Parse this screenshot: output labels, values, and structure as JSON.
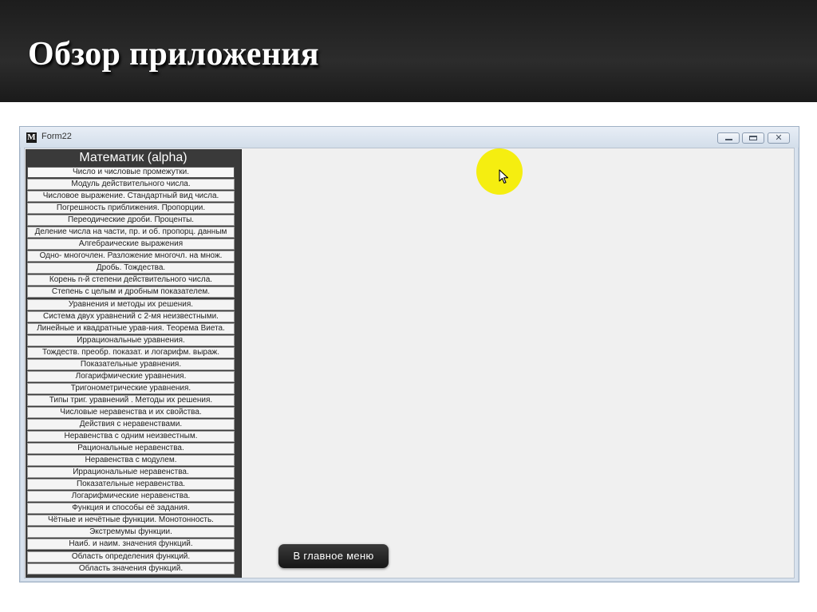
{
  "slide": {
    "title": "Обзор приложения"
  },
  "window": {
    "title": "Form22",
    "icon_letter": "M",
    "controls": {
      "minimize": "minimize-icon",
      "maximize": "maximize-icon",
      "close": "close-icon"
    }
  },
  "menu": {
    "header": "Математик (alpha)",
    "selected_index": 0,
    "items": [
      "Число и числовые промежутки.",
      "Модуль действительного числа.",
      "Числовое выражение. Стандартный вид числа.",
      "Погрешность приближения. Пропорции.",
      "Переодические дроби. Проценты.",
      "Деление числа на части, пр. и об. пропорц. данным",
      "Алгебраические выражения",
      "Одно- многочлен. Разложение многочл. на множ.",
      "Дробь. Тождества.",
      "Корень n-й степени действительного числа.",
      "Степень с целым и дробным показателем.",
      "Уравнения и методы их решения.",
      "Система двух уравнений с 2-мя неизвестными.",
      "Линейные и квадратные урав-ния. Теорема Виета.",
      "Иррациональные уравнения.",
      "Тождеств. преобр. показат. и логарифм. выраж.",
      "Показательные уравнения.",
      "Логарифмические уравнения.",
      "Тригонометрические уравнения.",
      "Типы триг. уравнений . Методы их решения.",
      "Числовые неравенства и их свойства.",
      "Действия с неравенствами.",
      "Неравенства с одним неизвестным.",
      "Рациональные неравенства.",
      "Неравенства с модулем.",
      "Иррациональные неравенства.",
      "Показательные неравенства.",
      "Логарифмические неравенства.",
      "Функция и способы её задания.",
      "Чётные и нечётные функции. Монотонность.",
      "Экстремумы функции.",
      "Наиб. и наим. значения функций.",
      "Область определения функций.",
      "Область значения функций."
    ]
  },
  "main_menu_button": {
    "label": "В главное меню"
  },
  "colors": {
    "cursor_highlight": "#f5ee10",
    "panel": "#3a3a3a",
    "header": "#222222"
  }
}
